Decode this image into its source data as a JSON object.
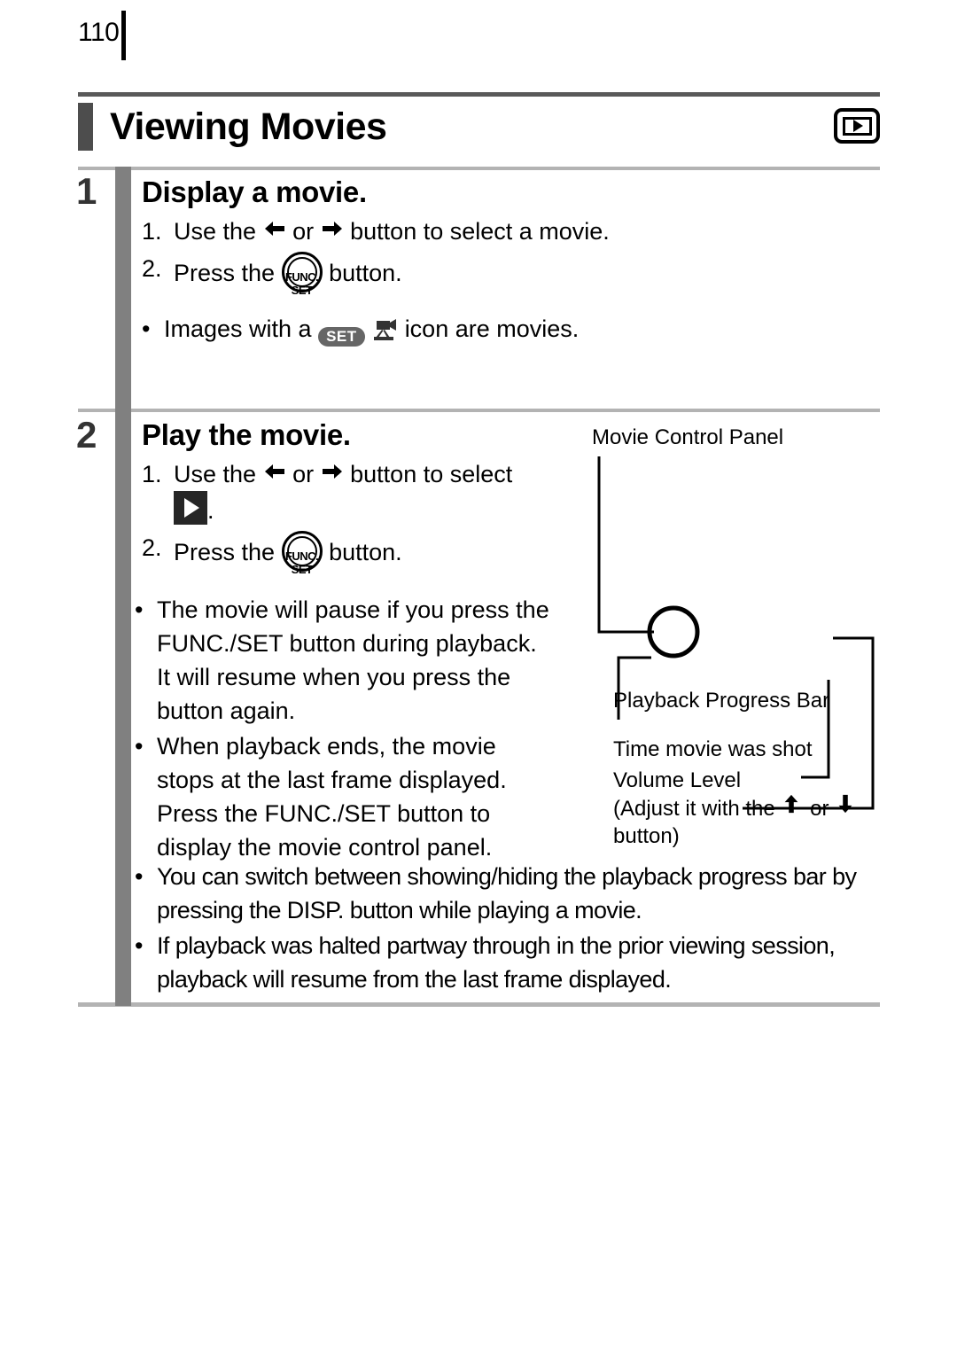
{
  "page": {
    "number": "110",
    "title": "Viewing Movies",
    "header_icon": "playback-mode-icon"
  },
  "steps": [
    {
      "number": "1",
      "heading": "Display a movie.",
      "ordered": [
        {
          "marker": "1.",
          "pre": "Use the",
          "mid": "or",
          "post": "button to select a movie."
        },
        {
          "marker": "2.",
          "pre": "Press the",
          "post": "button."
        }
      ],
      "notes": [
        {
          "pre": "Images with a",
          "post": "icon are movies."
        }
      ]
    },
    {
      "number": "2",
      "heading": "Play the movie.",
      "ordered": [
        {
          "marker": "1.",
          "pre": "Use the",
          "mid": "or",
          "post": "button to select",
          "tail": "."
        },
        {
          "marker": "2.",
          "pre": "Press the",
          "post": "button."
        }
      ]
    }
  ],
  "notes_column": [
    "The movie will pause if you press the FUNC./SET button during playback. It will resume when you press the button again.",
    "When playback ends, the movie stops at the last frame displayed. Press the FUNC./SET button to display the movie control panel."
  ],
  "notes_full": [
    "You can switch between showing/hiding the playback progress bar by pressing the DISP. button while playing a movie.",
    "If playback was halted partway through in the prior viewing session, playback will resume from the last frame displayed."
  ],
  "diagram": {
    "title": "Movie Control Panel",
    "callouts": [
      "Playback Progress Bar",
      "Time movie was shot",
      "Volume Level"
    ],
    "volume_note_pre": "(Adjust it with the",
    "volume_note_mid": "or",
    "volume_note_post": "button)"
  },
  "icons": {
    "left_arrow": "left-arrow-icon",
    "right_arrow": "right-arrow-icon",
    "up_arrow": "up-arrow-icon",
    "down_arrow": "down-arrow-icon",
    "func_set_top": "FUNC.",
    "func_set_bottom": "SET",
    "set_pill": "SET",
    "movie_camera": "movie-camera-icon",
    "play": "play-icon"
  },
  "colors": {
    "title_block": "#4d4d4d",
    "title_rule": "#595959",
    "vertical_bar": "#808080",
    "divider": "#b3b3b3",
    "set_pill_bg": "#666666",
    "play_square": "#262626"
  }
}
